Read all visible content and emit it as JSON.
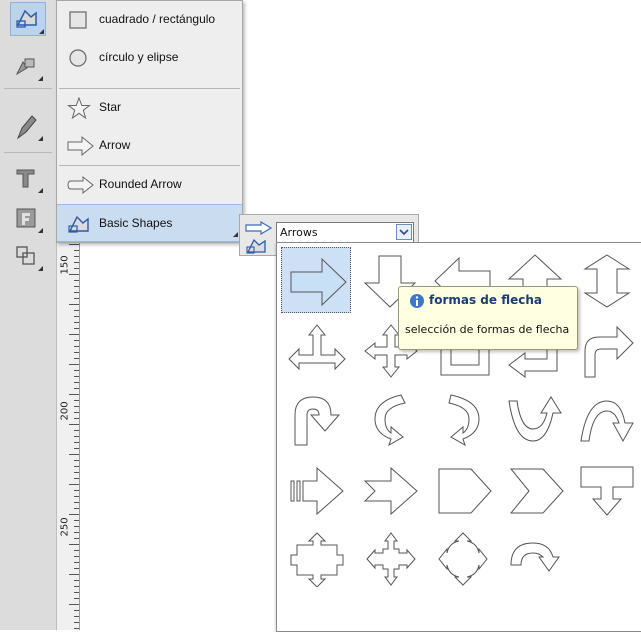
{
  "menu": {
    "items": [
      {
        "label": "cuadrado / rectángulo",
        "icon": "square-icon"
      },
      {
        "label": "círculo y elipse",
        "icon": "circle-icon"
      },
      {
        "label": "Star",
        "icon": "star-icon"
      },
      {
        "label": "Arrow",
        "icon": "arrow-icon"
      },
      {
        "label": "Rounded Arrow",
        "icon": "rounded-arrow-icon"
      },
      {
        "label": "Basic Shapes",
        "icon": "basic-shapes-icon"
      }
    ]
  },
  "selector": {
    "dropdown_value": "Arrows",
    "options": [
      "Arrows"
    ]
  },
  "tooltip": {
    "title": "formas de flecha",
    "text": "selección de formas de flecha"
  },
  "ruler": {
    "labels": [
      "150",
      "200",
      "250"
    ]
  },
  "shapes": {
    "selected_index": 0,
    "items": [
      "right-arrow",
      "down-arrow",
      "left-arrow",
      "up-arrow",
      "up-down-arrow",
      "three-way-arrow",
      "four-way-arrow",
      "corner-arrow",
      "bent-arrow",
      "bent-up-arrow",
      "u-turn-arrow",
      "circular-arrow",
      "curved-arrow",
      "curved-up-arrow",
      "curved-down-arrow",
      "striped-arrow",
      "chevron-arrow",
      "pentagon",
      "chevron",
      "callout-down-arrow",
      "cross-arrow-callout",
      "quad-arrow",
      "quad-arrow-rounded",
      "circular-arrow-2"
    ]
  },
  "colors": {
    "selection": "#cde0f5",
    "accent": "#3a6fb5",
    "tooltip_bg": "#ffffe1"
  }
}
